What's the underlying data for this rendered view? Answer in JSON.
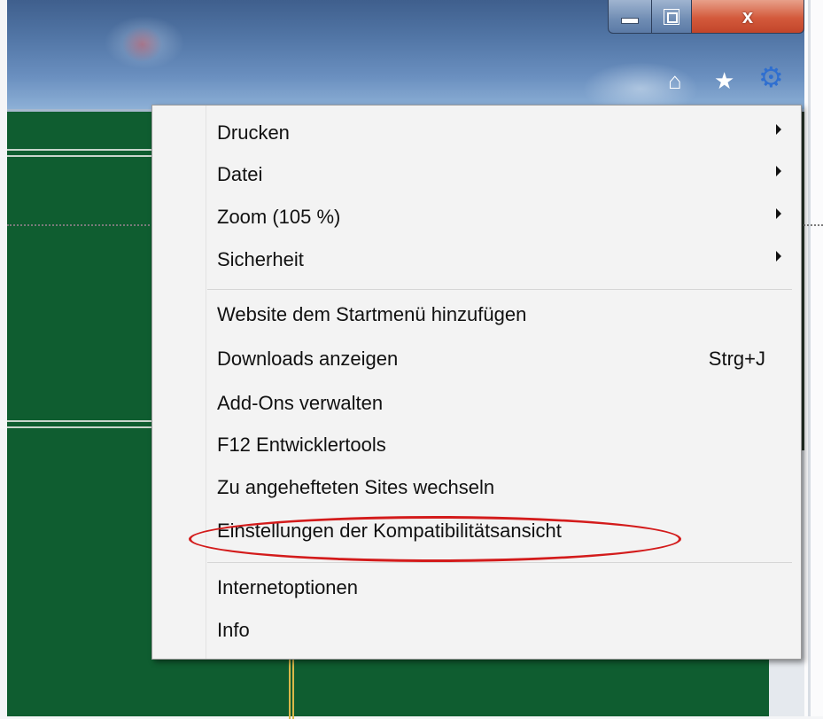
{
  "window_controls": {
    "minimize_icon": "minimize-icon",
    "maximize_icon": "restore-icon",
    "close_label": "x"
  },
  "toolbar": {
    "home_icon": "⌂",
    "favorites_icon": "★",
    "tools_icon": "⚙"
  },
  "menu": {
    "items": [
      {
        "label": "Drucken",
        "has_submenu": true
      },
      {
        "label": "Datei",
        "has_submenu": true
      },
      {
        "label": "Zoom (105 %)",
        "has_submenu": true
      },
      {
        "label": "Sicherheit",
        "has_submenu": true
      },
      {
        "label": "Website dem Startmenü hinzufügen"
      },
      {
        "label": "Downloads anzeigen",
        "shortcut": "Strg+J"
      },
      {
        "label": "Add-Ons verwalten"
      },
      {
        "label": "F12 Entwicklertools"
      },
      {
        "label": "Zu angehefteten Sites wechseln"
      },
      {
        "label": "Einstellungen der Kompatibilitätsansicht",
        "highlighted": true
      },
      {
        "label": "Internetoptionen"
      },
      {
        "label": "Info"
      }
    ]
  },
  "colors": {
    "page_background": "#0f5d30",
    "highlight_oval": "#d31b1b",
    "tools_icon": "#2f6fd0"
  }
}
